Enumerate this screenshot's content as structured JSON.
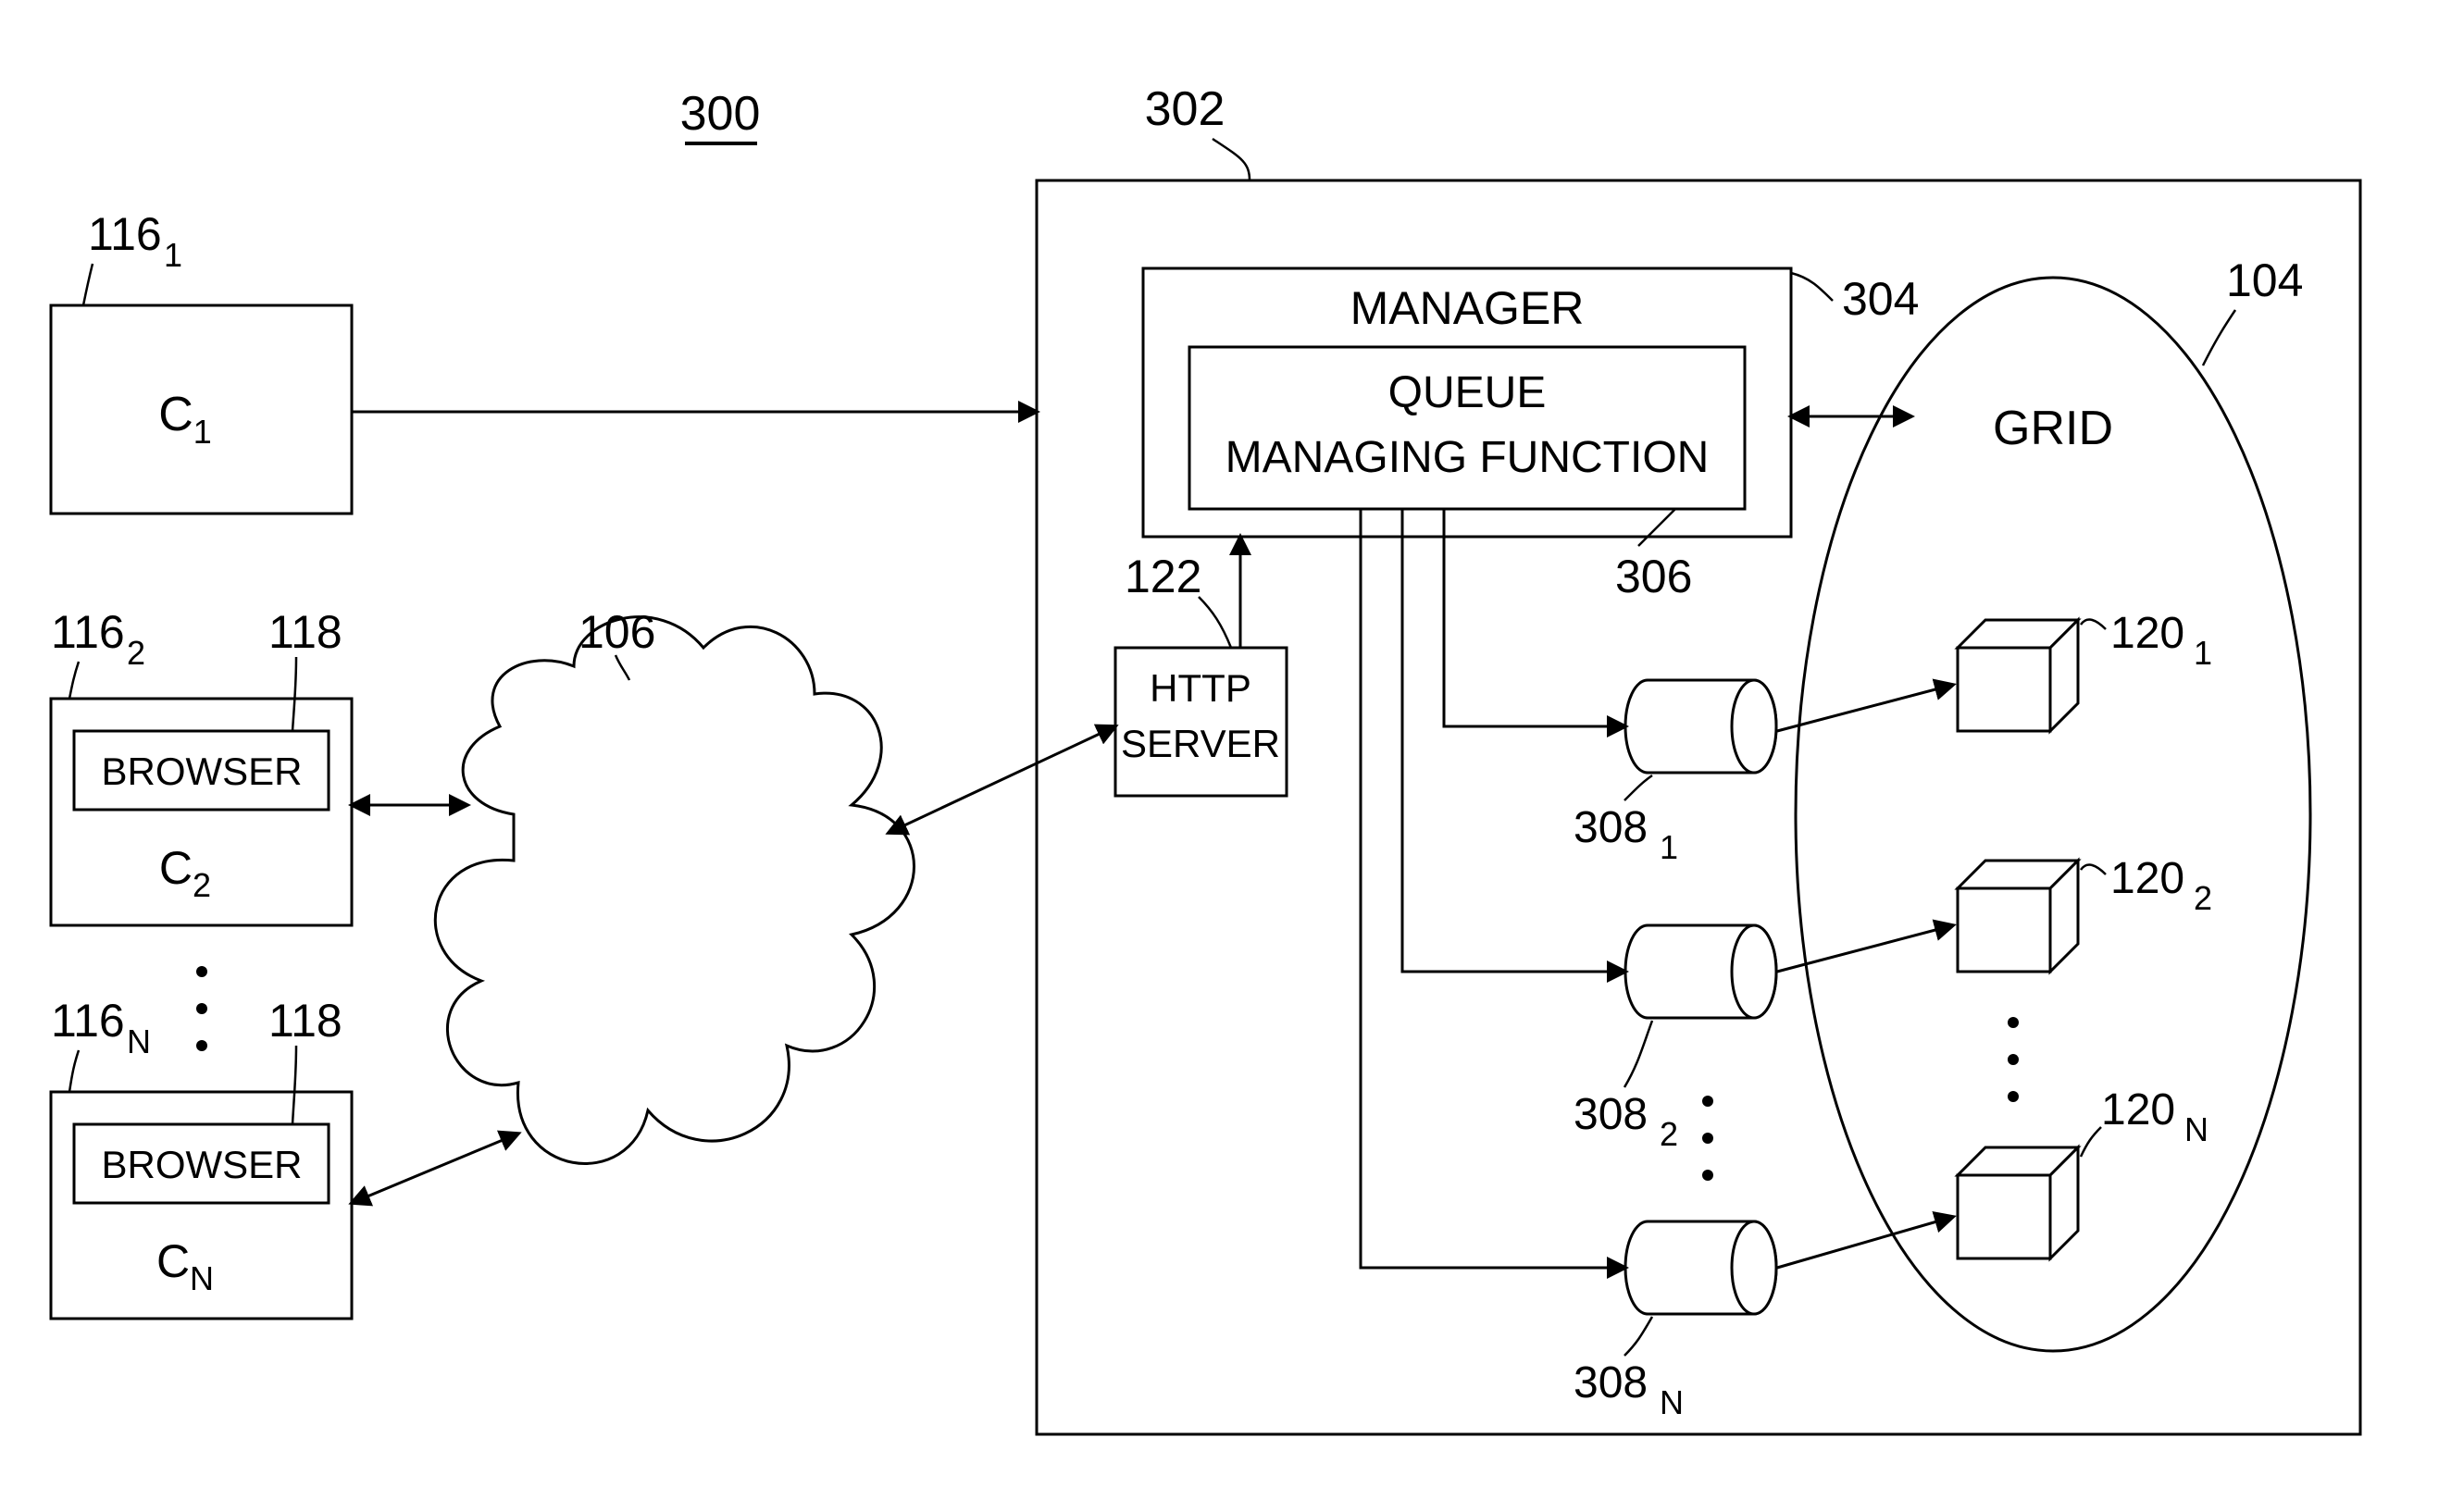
{
  "refs": {
    "main": "300",
    "container": "302",
    "manager_ref": "304",
    "qmf_ref": "306",
    "grid_ref": "104",
    "http_ref": "122",
    "cloud_ref": "106",
    "c1_ref": "116",
    "c1_sub": "1",
    "c2_ref": "116",
    "c2_sub": "2",
    "cn_ref": "116",
    "cn_sub": "N",
    "b2_ref": "118",
    "bn_ref": "118",
    "db1_ref": "308",
    "db1_sub": "1",
    "db2_ref": "308",
    "db2_sub": "2",
    "dbn_ref": "308",
    "dbn_sub": "N",
    "n1_ref": "120",
    "n1_sub": "1",
    "n2_ref": "120",
    "n2_sub": "2",
    "nn_ref": "120",
    "nn_sub": "N"
  },
  "labels": {
    "c1": "C",
    "c1_sub": "1",
    "c2": "C",
    "c2_sub": "2",
    "cn": "C",
    "cn_sub": "N",
    "browser": "BROWSER",
    "manager": "MANAGER",
    "queue": "QUEUE",
    "qmf": "MANAGING FUNCTION",
    "http1": "HTTP",
    "http2": "SERVER",
    "grid": "GRID"
  }
}
